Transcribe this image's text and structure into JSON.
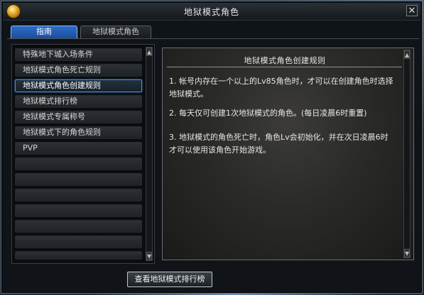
{
  "window": {
    "title": "地狱模式角色",
    "close_glyph": "✕"
  },
  "tabs": [
    {
      "label": "指南",
      "active": true
    },
    {
      "label": "地狱模式角色",
      "active": false
    }
  ],
  "guide_list": {
    "items": [
      {
        "label": "特殊地下城入场条件",
        "selected": false
      },
      {
        "label": "地狱模式角色死亡规则",
        "selected": false
      },
      {
        "label": "地狱模式角色创建规则",
        "selected": true
      },
      {
        "label": "地狱模式排行榜",
        "selected": false
      },
      {
        "label": "地狱模式专属称号",
        "selected": false
      },
      {
        "label": "地狱模式下的角色规则",
        "selected": false
      },
      {
        "label": "PVP",
        "selected": false
      },
      {
        "label": "",
        "selected": false
      },
      {
        "label": "",
        "selected": false
      },
      {
        "label": "",
        "selected": false
      },
      {
        "label": "",
        "selected": false
      },
      {
        "label": "",
        "selected": false
      },
      {
        "label": "",
        "selected": false
      },
      {
        "label": "",
        "selected": false
      }
    ]
  },
  "content": {
    "title": "地狱模式角色创建规则",
    "paragraphs": [
      {
        "line1": "1. 帐号内存在一个以上的Lv85角色时，才可以在创建角色时选择",
        "line2": "地狱模式。"
      },
      {
        "line1": "2. 每天仅可创建1次地狱模式的角色。(每日凌晨6时重置)",
        "line2": ""
      },
      {
        "line1": "3. 地狱模式的角色死亡时，角色Lv会初始化，并在次日凌晨6时",
        "line2": "才可以使用该角色开始游戏。"
      }
    ]
  },
  "scroll_glyphs": {
    "up": "▲",
    "down": "▼"
  },
  "bottom_button": {
    "label": "查看地狱模式排行榜"
  },
  "colors": {
    "selected_border": "#4c8ad8",
    "active_tab": "#2e6cc7"
  }
}
